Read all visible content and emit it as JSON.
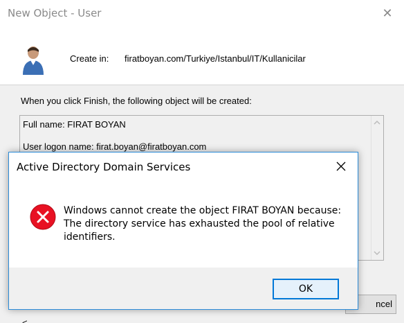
{
  "wizard": {
    "title": "New Object - User",
    "create_in_label": "Create in:",
    "create_in_path": "firatboyan.com/Turkiye/Istanbul/IT/Kullanicilar",
    "info_text": "When you click Finish, the following object will be created:",
    "summary_full_name": "Full name: FIRAT BOYAN",
    "summary_logon": "User logon name: firat.boyan@firatboyan.com",
    "cancel_label": "ncel",
    "back_label_fragment": "< Back"
  },
  "dialog": {
    "title": "Active Directory Domain Services",
    "message_lines": [
      "Windows cannot create the object FIRAT BOYAN because:",
      "The directory service has exhausted the pool of relative",
      "identifiers."
    ],
    "ok_label": "OK"
  },
  "icons": {
    "close": "close-icon",
    "error": "error-icon",
    "user": "user-avatar-icon"
  },
  "colors": {
    "accent": "#0078d7",
    "error_red": "#e81123",
    "dialog_border": "#2a8bd8"
  }
}
